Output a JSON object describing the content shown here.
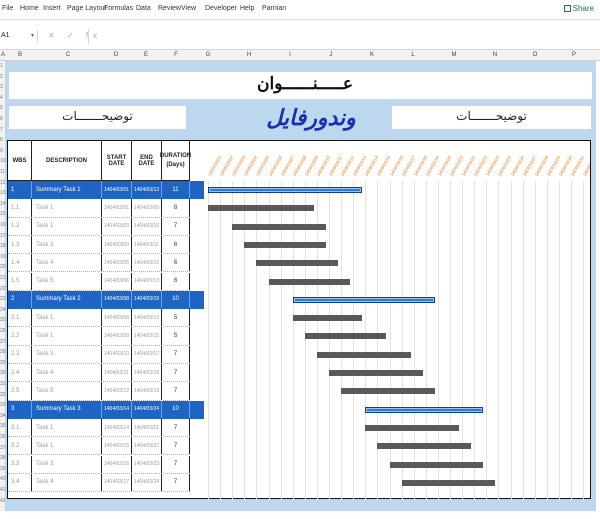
{
  "ribbon": {
    "tabs": [
      "File",
      "Home",
      "Insert",
      "Page Layout",
      "Formulas",
      "Data",
      "Review",
      "View",
      "Developer",
      "Help",
      "Parnian"
    ],
    "share_label": "Share"
  },
  "formula_bar": {
    "name_box": "A1",
    "icons": "✕ ✓ fx",
    "value": ""
  },
  "columns": [
    "A",
    "B",
    "C",
    "D",
    "E",
    "F",
    "G",
    "H",
    "I",
    "J",
    "K",
    "L",
    "M",
    "N",
    "O",
    "P"
  ],
  "row_numbers": [
    "1",
    "2",
    "3",
    "4",
    "5",
    "6",
    "7",
    "8",
    "9",
    "10",
    "11",
    "12",
    "13",
    "14",
    "15",
    "16",
    "17",
    "18",
    "19",
    "20",
    "21",
    "22",
    "23",
    "24",
    "25",
    "26",
    "27",
    "28",
    "29",
    "30",
    "31",
    "32",
    "33",
    "34",
    "35",
    "36",
    "37",
    "38",
    "39",
    "40",
    "41",
    "42"
  ],
  "sheet": {
    "title": "عـــــنــــــوان",
    "description_left": "توضیحـــــــات",
    "description_right": "توضیحـــــــات",
    "brand": "وندورفایل"
  },
  "table": {
    "headers": {
      "wbs": "WBS",
      "description": "DESCRIPTION",
      "start_date": "START DATE",
      "end_date": "END DATE",
      "duration": "DURATION (Days)"
    },
    "rows": [
      {
        "wbs": "1",
        "description": "Summary Task 1",
        "start": "1404/03/01",
        "end": "1404/03/13",
        "duration": "11",
        "summary": true,
        "bar_start": 0,
        "bar_len": 13
      },
      {
        "wbs": "1.1",
        "description": "Task 1",
        "start": "1404/03/01",
        "end": "1404/03/09",
        "duration": "8",
        "summary": false,
        "bar_start": 0,
        "bar_len": 9
      },
      {
        "wbs": "1.2",
        "description": "Task 1",
        "start": "1404/03/03",
        "end": "1404/03/10",
        "duration": "7",
        "summary": false,
        "bar_start": 2,
        "bar_len": 8
      },
      {
        "wbs": "1.3",
        "description": "Task 3",
        "start": "1404/03/03",
        "end": "1404/03/11",
        "duration": "6",
        "summary": false,
        "bar_start": 3,
        "bar_len": 7
      },
      {
        "wbs": "1.4",
        "description": "Task 4",
        "start": "1404/03/05",
        "end": "1404/03/12",
        "duration": "6",
        "summary": false,
        "bar_start": 4,
        "bar_len": 7
      },
      {
        "wbs": "1.5",
        "description": "Task 5",
        "start": "1404/03/06",
        "end": "1404/03/13",
        "duration": "6",
        "summary": false,
        "bar_start": 5,
        "bar_len": 7
      },
      {
        "wbs": "2",
        "description": "Summary Task 2",
        "start": "1404/03/08",
        "end": "1404/03/19",
        "duration": "10",
        "summary": true,
        "bar_start": 7,
        "bar_len": 12
      },
      {
        "wbs": "2.1",
        "description": "Task 1",
        "start": "1404/03/08",
        "end": "1404/03/13",
        "duration": "5",
        "summary": false,
        "bar_start": 7,
        "bar_len": 6
      },
      {
        "wbs": "2.2",
        "description": "Task 1",
        "start": "1404/03/09",
        "end": "1404/03/15",
        "duration": "5",
        "summary": false,
        "bar_start": 8,
        "bar_len": 7
      },
      {
        "wbs": "2.3",
        "description": "Task 3",
        "start": "1404/03/10",
        "end": "1404/03/17",
        "duration": "7",
        "summary": false,
        "bar_start": 9,
        "bar_len": 8
      },
      {
        "wbs": "2.4",
        "description": "Task 4",
        "start": "1404/03/11",
        "end": "1404/03/18",
        "duration": "7",
        "summary": false,
        "bar_start": 10,
        "bar_len": 8
      },
      {
        "wbs": "2.5",
        "description": "Task 5",
        "start": "1404/03/12",
        "end": "1404/03/19",
        "duration": "7",
        "summary": false,
        "bar_start": 11,
        "bar_len": 8
      },
      {
        "wbs": "3",
        "description": "Summary Task 3",
        "start": "1404/03/14",
        "end": "1404/03/24",
        "duration": "10",
        "summary": true,
        "bar_start": 13,
        "bar_len": 10
      },
      {
        "wbs": "3.1",
        "description": "Task 1",
        "start": "1404/03/14",
        "end": "1404/03/21",
        "duration": "7",
        "summary": false,
        "bar_start": 13,
        "bar_len": 8
      },
      {
        "wbs": "3.2",
        "description": "Task 1",
        "start": "1404/03/15",
        "end": "1404/03/22",
        "duration": "7",
        "summary": false,
        "bar_start": 14,
        "bar_len": 8
      },
      {
        "wbs": "3.3",
        "description": "Task 3",
        "start": "1404/03/16",
        "end": "1404/03/23",
        "duration": "7",
        "summary": false,
        "bar_start": 15,
        "bar_len": 8
      },
      {
        "wbs": "3.4",
        "description": "Task 4",
        "start": "1404/03/17",
        "end": "1404/03/24",
        "duration": "7",
        "summary": false,
        "bar_start": 16,
        "bar_len": 8
      }
    ],
    "timeline_dates": [
      "1404/03/01",
      "1404/03/02",
      "1404/03/03",
      "1404/03/04",
      "1404/03/05",
      "1404/03/06",
      "1404/03/07",
      "1404/03/08",
      "1404/03/09",
      "1404/03/10",
      "1404/03/11",
      "1404/03/12",
      "1404/03/13",
      "1404/03/14",
      "1404/03/15",
      "1404/03/16",
      "1404/03/17",
      "1404/03/18",
      "1404/03/19",
      "1404/03/20",
      "1404/03/21",
      "1404/03/22",
      "1404/03/23",
      "1404/03/24",
      "1404/03/25",
      "1404/03/26",
      "1404/03/27",
      "1404/03/28",
      "1404/03/29",
      "1404/03/30",
      "1404/03/31",
      "1404/04/01"
    ]
  },
  "colors": {
    "summary_row": "#1f64c2",
    "summary_bar": "#2a7ce0",
    "task_bar": "#595959",
    "date_label": "#e07b1f",
    "sheet_bg": "#bdd7ee",
    "brand": "#1a2fb0"
  }
}
